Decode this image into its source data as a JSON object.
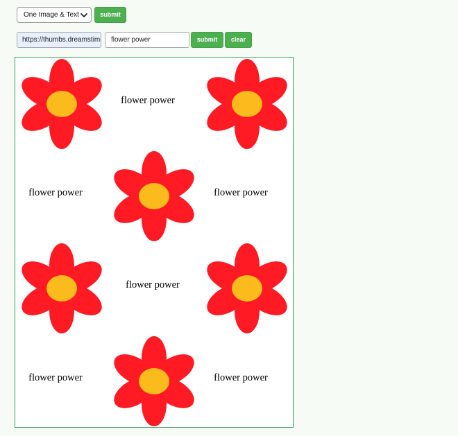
{
  "toolbar": {
    "mode_selected": "One Image & Text",
    "submit_label": "submit"
  },
  "form": {
    "url_value": "https://thumbs.dreamstime.com",
    "text_value": "flower power",
    "submit_label": "submit",
    "clear_label": "clear"
  },
  "grid": {
    "caption": "flower power"
  },
  "colors": {
    "petal": "#ff1a24",
    "center": "#fbbb1c",
    "button": "#4caf50",
    "frame": "#3a9a5a"
  },
  "icons": {
    "select": "chevron-down-icon",
    "flower": "flower-icon"
  }
}
